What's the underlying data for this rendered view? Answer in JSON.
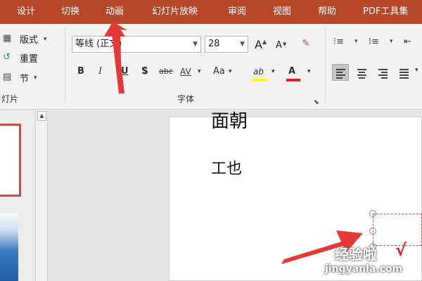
{
  "menu": {
    "tabs": [
      {
        "id": "design",
        "label": "设计"
      },
      {
        "id": "transitions",
        "label": "切换"
      },
      {
        "id": "animations",
        "label": "动画"
      },
      {
        "id": "slideshow",
        "label": "幻灯片放映"
      },
      {
        "id": "review",
        "label": "审阅"
      },
      {
        "id": "view",
        "label": "视图"
      },
      {
        "id": "help",
        "label": "帮助"
      },
      {
        "id": "pdf",
        "label": "PDF工具集"
      }
    ]
  },
  "ribbon": {
    "slides_group": {
      "layout_label": "版式",
      "reset_label": "重置",
      "section_label": "节",
      "group_label": "灯片"
    },
    "font_group": {
      "font_name": "等线 (正文)",
      "font_size": "28",
      "increase_font": "A",
      "decrease_font": "A",
      "bold": "B",
      "italic": "I",
      "underline": "U",
      "shadow": "S",
      "strikethrough": "abc",
      "char_spacing": "AV",
      "change_case": "Aa",
      "highlight": "ab",
      "font_color": "A",
      "group_label": "字体"
    }
  },
  "slide": {
    "text_line1": "面朝",
    "text_line2": "工也"
  },
  "watermark": {
    "text": "经验啦",
    "check": "√",
    "url": "jingyanla.com"
  },
  "colors": {
    "menu_bg": "#b7472a",
    "annotation_arrow": "#e53935",
    "highlight_yellow": "#ffff00",
    "font_color_red": "#e02020"
  }
}
